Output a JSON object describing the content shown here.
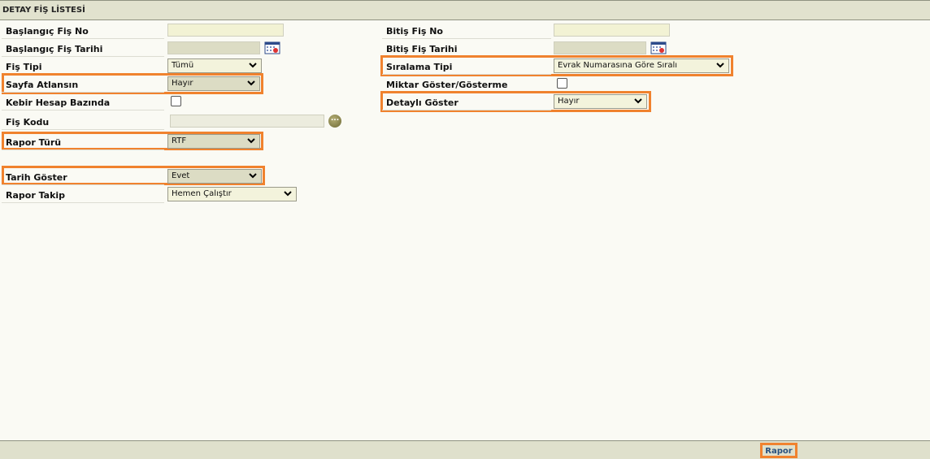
{
  "title": "DETAY FİŞ LİSTESİ",
  "fields": {
    "baslangic_fis_no": {
      "label": "Başlangıç Fiş No",
      "value": ""
    },
    "bitis_fis_no": {
      "label": "Bitiş Fiş No",
      "value": ""
    },
    "baslangic_fis_tarihi": {
      "label": "Başlangıç Fiş Tarihi",
      "value": ""
    },
    "bitis_fis_tarihi": {
      "label": "Bitiş Fiş Tarihi",
      "value": ""
    },
    "fis_tipi": {
      "label": "Fiş Tipi",
      "value": "Tümü"
    },
    "siralama_tipi": {
      "label": "Sıralama Tipi",
      "value": "Evrak Numarasına Göre Sıralı"
    },
    "sayfa_atlansin": {
      "label": "Sayfa Atlansın",
      "value": "Hayır"
    },
    "miktar_goster": {
      "label": "Miktar Göster/Gösterme",
      "checked": false
    },
    "kebir_hesap": {
      "label": "Kebir Hesap Bazında",
      "checked": false
    },
    "detayli_goster": {
      "label": "Detaylı Göster",
      "value": "Hayır"
    },
    "fis_kodu": {
      "label": "Fiş Kodu",
      "value": ""
    },
    "rapor_turu": {
      "label": "Rapor Türü",
      "value": "RTF"
    },
    "tarih_goster": {
      "label": "Tarih Göster",
      "value": "Evet"
    },
    "rapor_takip": {
      "label": "Rapor Takip",
      "value": "Hemen Çalıştır"
    }
  },
  "buttons": {
    "rapor": "Rapor",
    "lookup": "..."
  },
  "icons": {
    "calendar": "calendar-icon",
    "chevron": "chevron-down-icon",
    "lookup": "ellipsis-icon"
  },
  "colors": {
    "highlight": "#f0822e",
    "header_bg": "#e1e2ce",
    "input_bg": "#f2f2d4"
  }
}
